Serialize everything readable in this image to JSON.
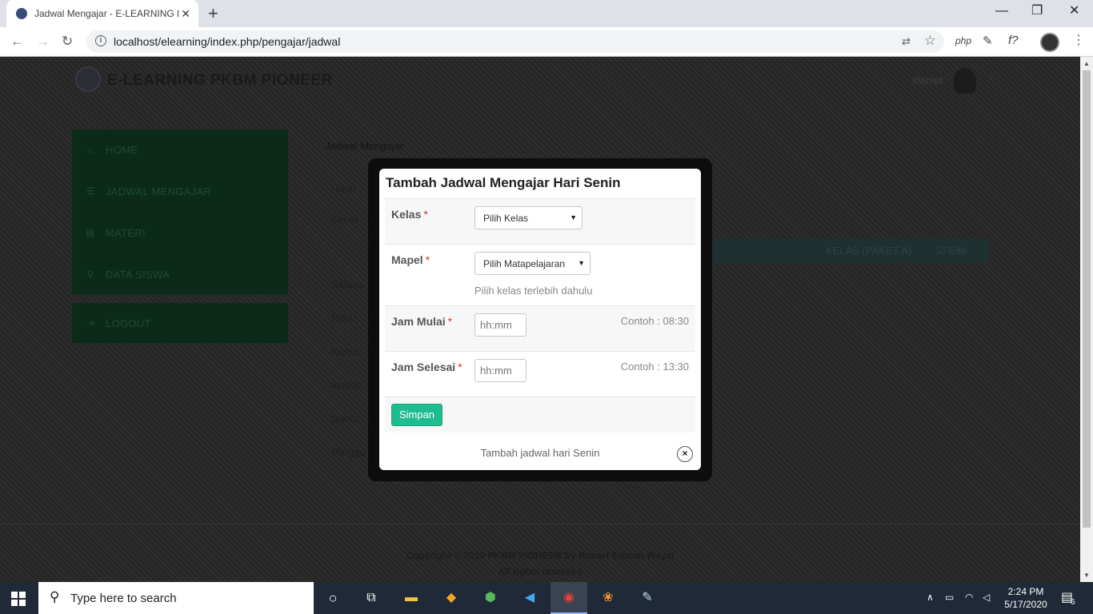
{
  "browser": {
    "tab_title": "Jadwal Mengajar - E-LEARNING P",
    "tab_close": "✕",
    "new_tab": "+",
    "url": "localhost/elearning/index.php/pengajar/jadwal",
    "ext_php": "php",
    "ext_f": "f?",
    "win_minimize": "—",
    "win_restore": "❐",
    "win_close": "✕"
  },
  "site": {
    "title": "E-LEARNING PKBM PIONEER",
    "user_name": "slamet"
  },
  "sidebar": {
    "items": [
      {
        "icon": "home-icon",
        "glyph": "⌂",
        "label": "HOME"
      },
      {
        "icon": "list-icon",
        "glyph": "☰",
        "label": "JADWAL MENGAJAR"
      },
      {
        "icon": "book-icon",
        "glyph": "▤",
        "label": "MATERI"
      },
      {
        "icon": "search-icon",
        "glyph": "⚲",
        "label": "DATA SISWA"
      }
    ],
    "logout": {
      "icon": "logout-icon",
      "glyph": "⇥",
      "label": "LOGOUT"
    }
  },
  "content": {
    "heading": "Jadwal Mengajar",
    "col_hari": "HARI",
    "days": [
      "Senin",
      "Selasa",
      "Rabu",
      "Kamis",
      "Jum'at",
      "Sabtu",
      "Minggu"
    ],
    "row_kelas": "KELAS (PAKET A)",
    "row_edit": "☑ Edit"
  },
  "footer": {
    "copyright": "Copyright © 2020 PKBM PIONEER by Robert Edison Weyai",
    "rights": "All rights reserved"
  },
  "modal": {
    "title": "Tambah Jadwal Mengajar Hari Senin",
    "required_mark": "*",
    "kelas_label": "Kelas",
    "kelas_selected": "Pilih Kelas",
    "mapel_label": "Mapel",
    "mapel_selected": "Pilih Matapelajaran",
    "mapel_hint": "Pilih kelas terlebih dahulu",
    "jam_mulai_label": "Jam Mulai",
    "jam_mulai_placeholder": "hh:mm",
    "jam_mulai_example": "Contoh : 08:30",
    "jam_selesai_label": "Jam Selesai",
    "jam_selesai_placeholder": "hh:mm",
    "jam_selesai_example": "Contoh : 13:30",
    "submit_label": "Simpan",
    "caption": "Tambah jadwal hari Senin",
    "close_glyph": "×"
  },
  "taskbar": {
    "search_placeholder": "Type here to search",
    "time": "2:24 PM",
    "date": "5/17/2020",
    "notification_count": "6"
  }
}
